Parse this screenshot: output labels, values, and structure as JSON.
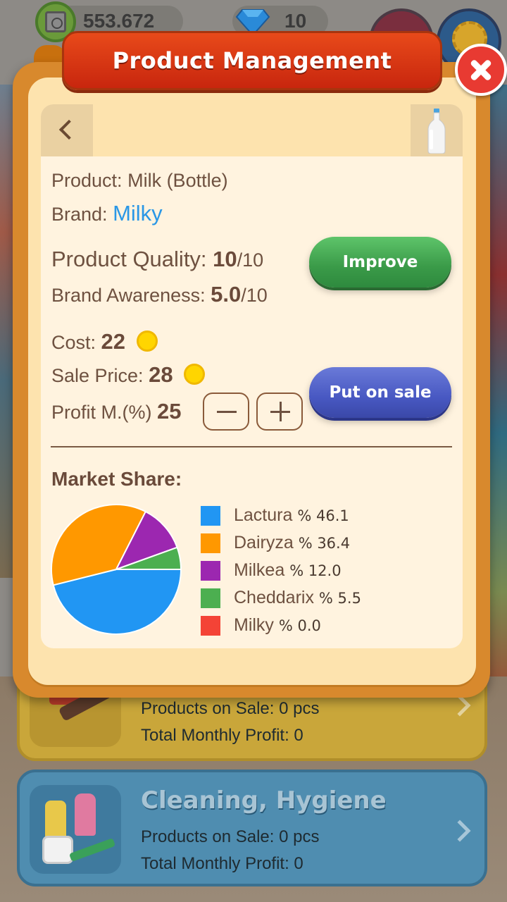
{
  "hud": {
    "money": "553.672",
    "gems": "10"
  },
  "categories": [
    {
      "title": "",
      "products_on_sale": "Products on Sale: 0 pcs",
      "total_monthly_profit": "Total Monthly Profit: 0"
    },
    {
      "title": "Cleaning, Hygiene",
      "products_on_sale": "Products on Sale: 0 pcs",
      "total_monthly_profit": "Total Monthly Profit: 0"
    }
  ],
  "modal": {
    "title": "Product Management",
    "product_label": "Product:",
    "product_name": "Milk (Bottle)",
    "brand_label": "Brand:",
    "brand_name": "Milky",
    "quality_label": "Product Quality:",
    "quality_value": "10",
    "quality_max": "/10",
    "awareness_label": "Brand Awareness:",
    "awareness_value": "5.0",
    "awareness_max": "/10",
    "cost_label": "Cost:",
    "cost_value": "22",
    "sale_price_label": "Sale Price:",
    "sale_price_value": "28",
    "profit_label": "Profit M.(%)",
    "profit_value": "25",
    "improve_label": "Improve",
    "put_on_sale_label": "Put on sale",
    "market_share_label": "Market Share:"
  },
  "colors": {
    "Lactura": "#2196f3",
    "Dairyza": "#ff9800",
    "Milkea": "#9c27b0",
    "Cheddarix": "#4caf50",
    "Milky": "#f44336"
  },
  "chart_data": {
    "type": "pie",
    "series": [
      {
        "name": "Lactura",
        "value": 46.1,
        "label": "% 46.1"
      },
      {
        "name": "Dairyza",
        "value": 36.4,
        "label": "% 36.4"
      },
      {
        "name": "Milkea",
        "value": 12.0,
        "label": "% 12.0"
      },
      {
        "name": "Cheddarix",
        "value": 5.5,
        "label": "% 5.5"
      },
      {
        "name": "Milky",
        "value": 0.0,
        "label": "% 0.0"
      }
    ]
  }
}
